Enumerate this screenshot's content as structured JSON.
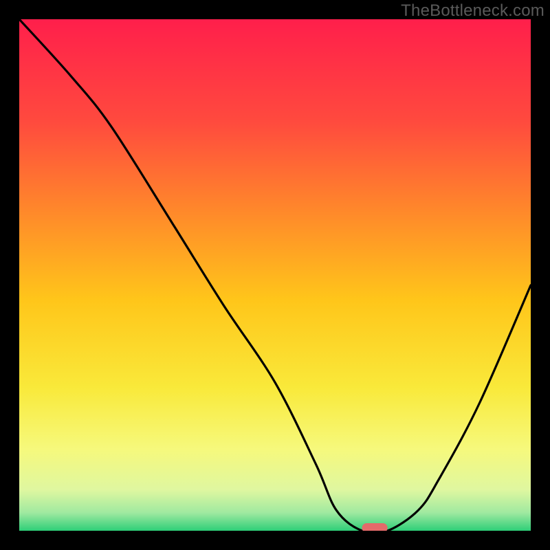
{
  "watermark": "TheBottleneck.com",
  "chart_data": {
    "type": "line",
    "title": "",
    "xlabel": "",
    "ylabel": "",
    "xlim": [
      0,
      100
    ],
    "ylim": [
      0,
      100
    ],
    "grid": false,
    "legend": false,
    "series": [
      {
        "name": "bottleneck-curve",
        "x": [
          0,
          10,
          18,
          30,
          40,
          50,
          58,
          62,
          67,
          72,
          78,
          82,
          90,
          100
        ],
        "values": [
          100,
          89,
          79,
          60,
          44,
          29,
          13,
          4,
          0,
          0,
          4,
          10,
          25,
          48
        ]
      }
    ],
    "marker": {
      "name": "sweet-spot",
      "x": 69.5,
      "y": 0,
      "width_x": 5,
      "color": "#e46a6a"
    },
    "gradient_stops": [
      {
        "offset": 0.0,
        "color": "#ff1f4b"
      },
      {
        "offset": 0.2,
        "color": "#ff4a3e"
      },
      {
        "offset": 0.38,
        "color": "#ff8a2a"
      },
      {
        "offset": 0.55,
        "color": "#ffc61a"
      },
      {
        "offset": 0.72,
        "color": "#f9e93a"
      },
      {
        "offset": 0.84,
        "color": "#f6f97c"
      },
      {
        "offset": 0.92,
        "color": "#dff7a0"
      },
      {
        "offset": 0.965,
        "color": "#9fe9a0"
      },
      {
        "offset": 1.0,
        "color": "#2ecf78"
      }
    ]
  }
}
